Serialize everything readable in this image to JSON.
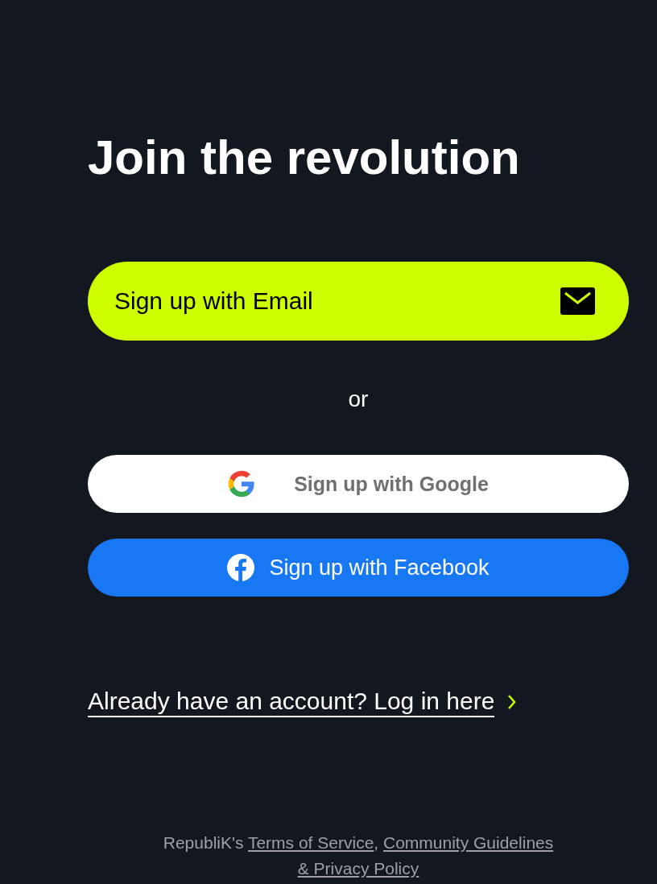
{
  "title": "Join the revolution",
  "buttons": [
    {
      "kind": "email",
      "label": "Sign up with Email"
    },
    {
      "kind": "google",
      "label": "Sign up with Google"
    },
    {
      "kind": "facebook",
      "label": "Sign up with Facebook"
    }
  ],
  "or_text": "or",
  "login_link": "Already have an account? Log in here",
  "footer": [
    {
      "kind": "text",
      "text": "RepubliK's "
    },
    {
      "kind": "link",
      "text": "Terms of Service"
    },
    {
      "kind": "text",
      "text": ", "
    },
    {
      "kind": "link",
      "text": "Community Guidelines"
    },
    {
      "kind": "link",
      "text": "& Privacy Policy"
    }
  ]
}
